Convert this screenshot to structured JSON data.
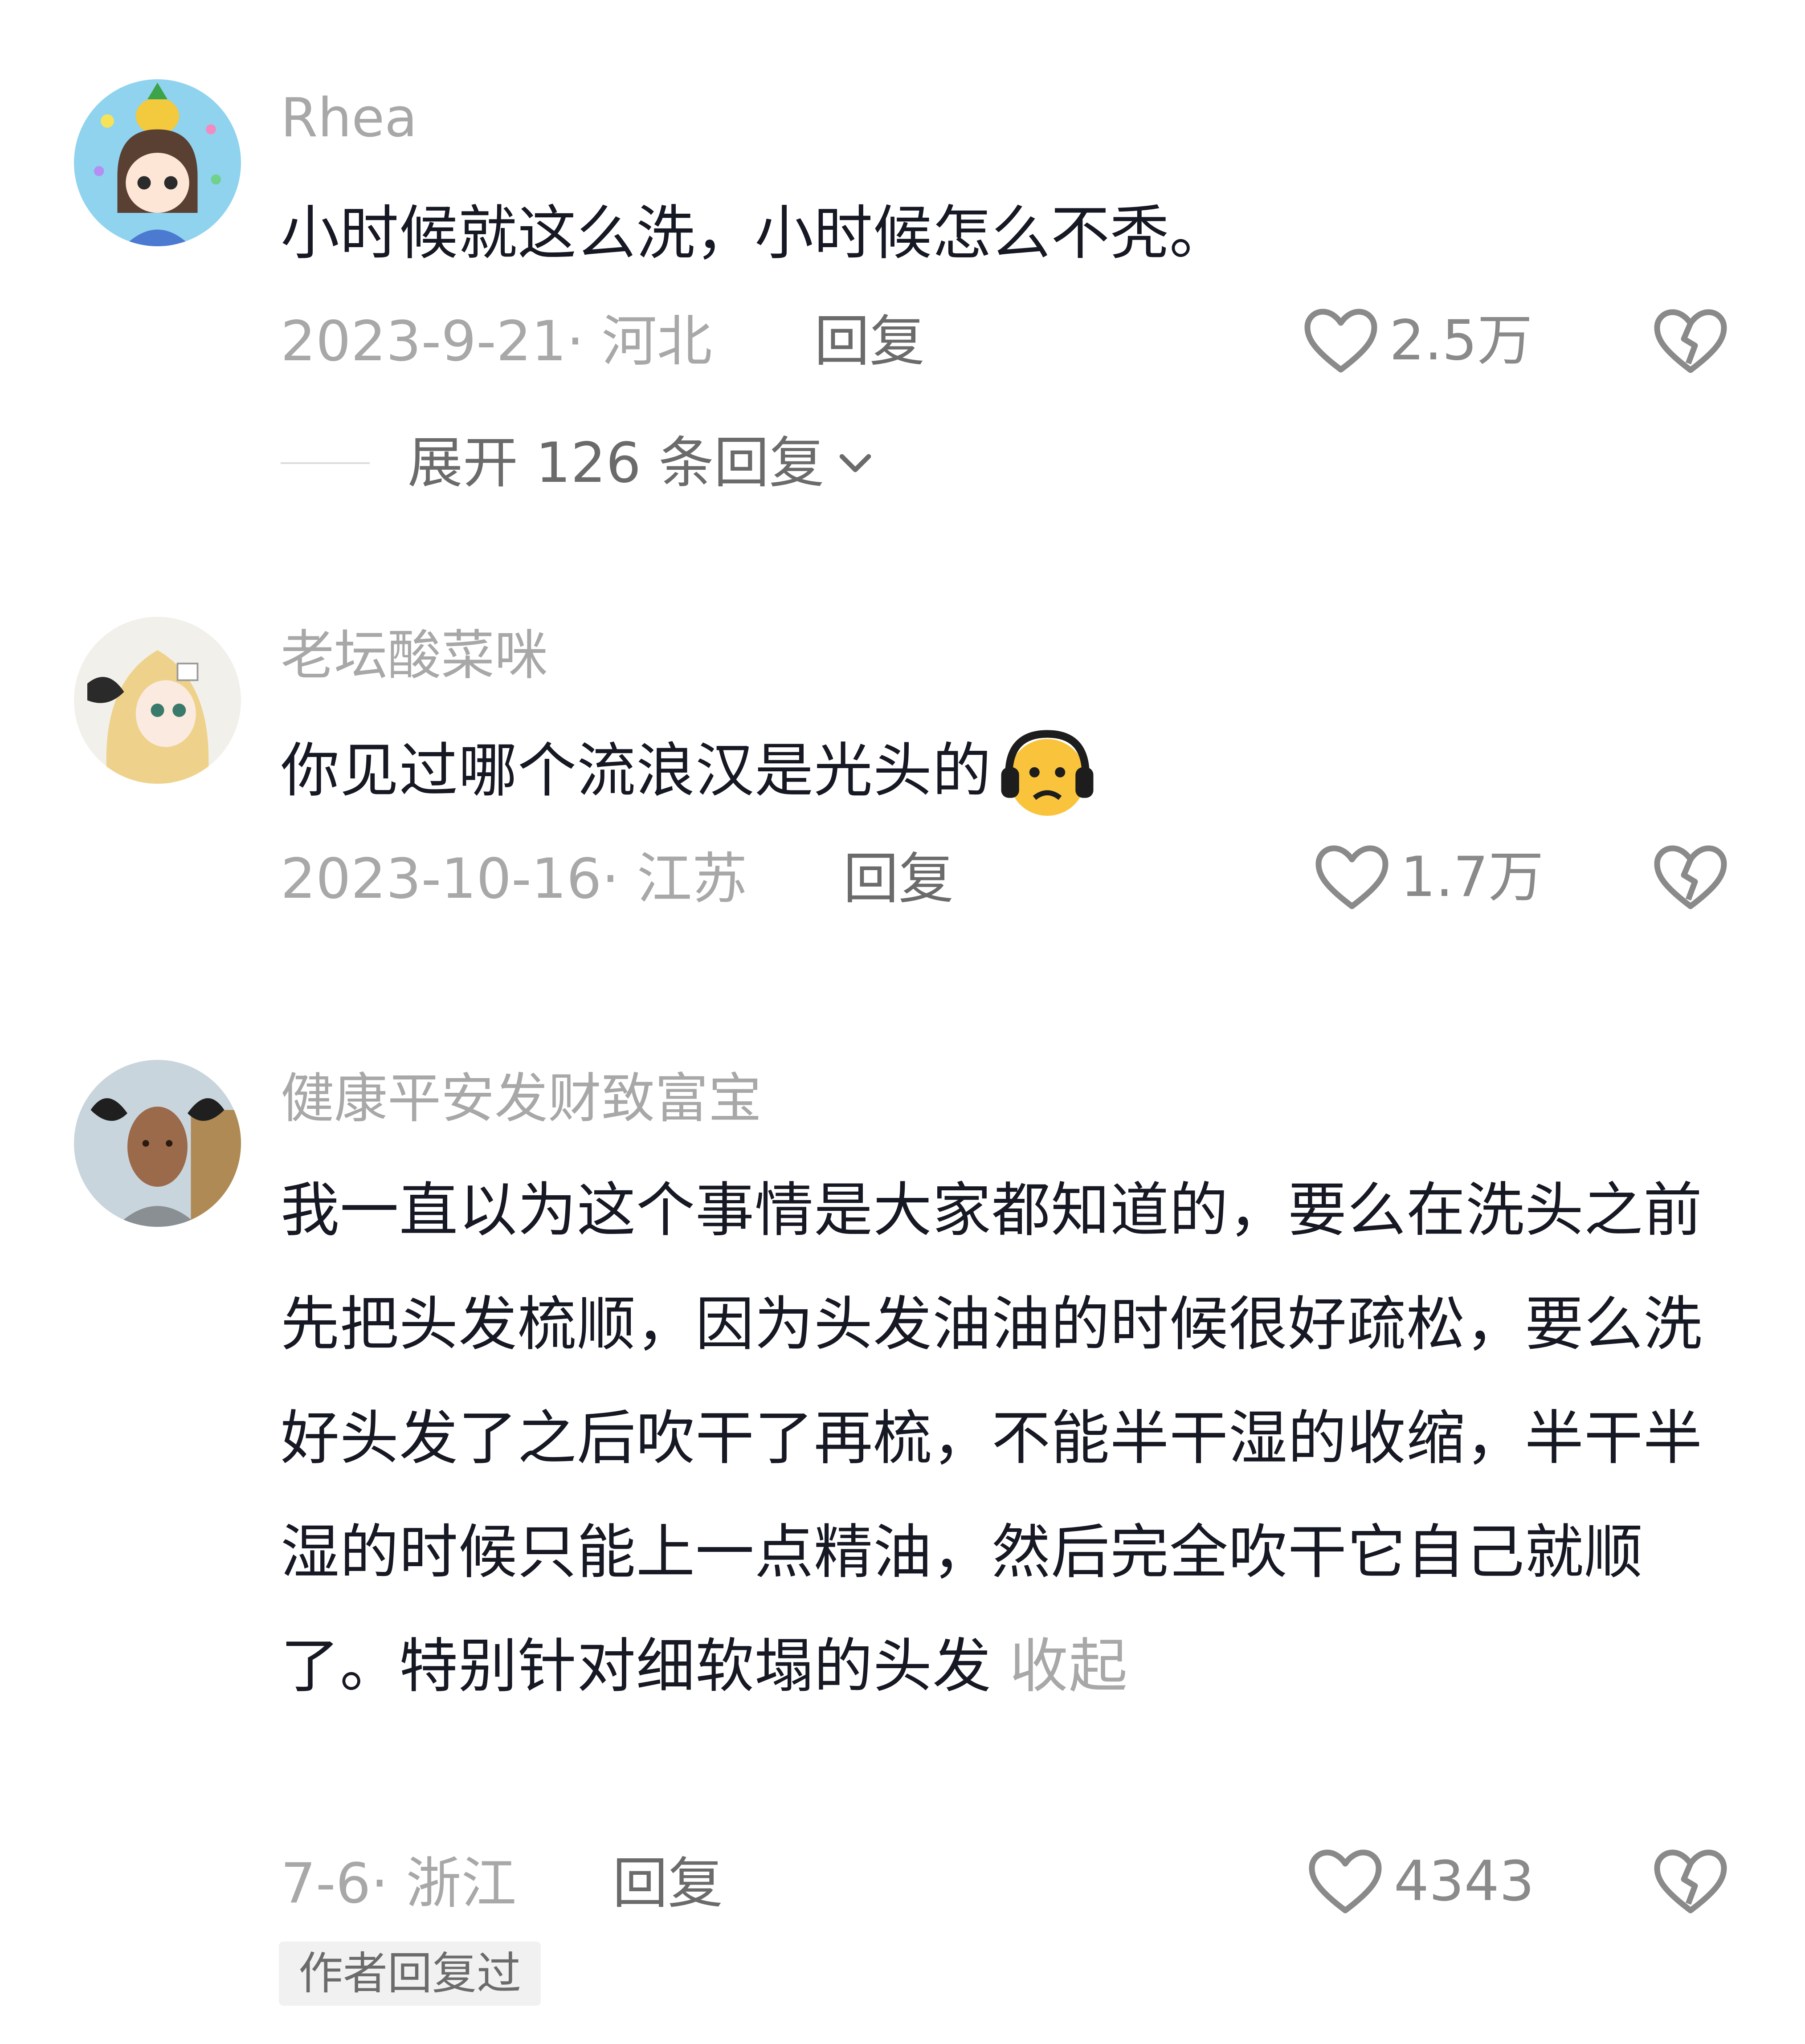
{
  "comments": [
    {
      "username": "Rhea",
      "text": "小时候就这么洗，小时候怎么不秃。",
      "date": "2023-9-21",
      "location": "河北",
      "reply_label": "回复",
      "likes": "2.5万",
      "expand_label": "展开 126 条回复",
      "avatar": "anime-girl-pineapple-avatar"
    },
    {
      "username": "老坛酸菜咪",
      "text": "你见过哪个流浪汉是光头的",
      "emoji": "sad-headphones-emoji",
      "date": "2023-10-16",
      "location": "江苏",
      "reply_label": "回复",
      "likes": "1.7万",
      "avatar": "blonde-anime-avatar"
    },
    {
      "username": "健康平安发财致富宝",
      "text": "我一直以为这个事情是大家都知道的，要么在洗头之前先把头发梳顺，因为头发油油的时候很好疏松，要么洗好头发了之后吹干了再梳，不能半干湿的收缩，半干半湿的时候只能上一点精油，然后完全吹干它自己就顺了。特别针对细软塌的头发",
      "collapse_label": "收起",
      "date": "7-6",
      "location": "浙江",
      "reply_label": "回复",
      "likes": "4343",
      "badge": "作者回复过",
      "avatar": "man-with-pigtails-avatar"
    }
  ],
  "icons": {
    "like": "heart-outline-icon",
    "dislike": "broken-heart-icon",
    "expand": "chevron-down-icon"
  },
  "colors": {
    "text": "#161823",
    "secondary": "#a8a8a8",
    "action": "#6b6b6b",
    "badge_bg": "#f1f1f2"
  }
}
